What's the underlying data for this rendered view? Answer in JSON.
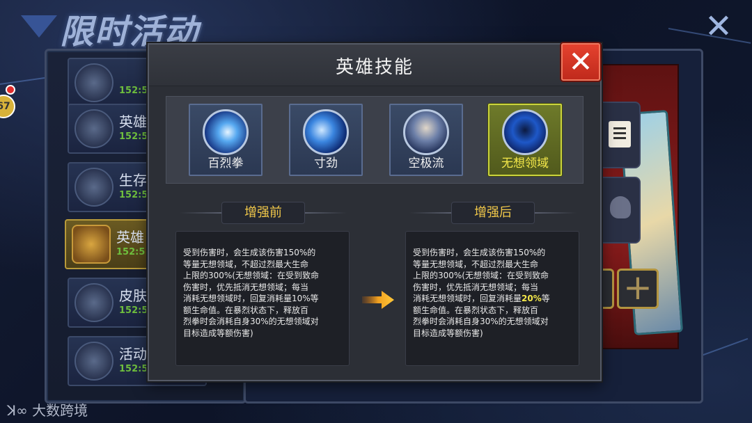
{
  "background": {
    "page_title": "限时活动",
    "list_items": [
      {
        "label": "",
        "time": "152:5"
      },
      {
        "label": "英雄",
        "time": "152:5"
      },
      {
        "label": "生存",
        "time": "152:5"
      },
      {
        "label": "英雄",
        "time": "152:5"
      },
      {
        "label": "皮肤",
        "time": "152:5"
      },
      {
        "label": "活动",
        "time": "152:5"
      }
    ],
    "badge_text": "67"
  },
  "dialog": {
    "title": "英雄技能",
    "skills": [
      {
        "label": "百烈拳",
        "icon": "fist-strike-icon",
        "selected": false
      },
      {
        "label": "寸劲",
        "icon": "energy-burst-icon",
        "selected": false
      },
      {
        "label": "空极流",
        "icon": "fighter-portrait-icon",
        "selected": false
      },
      {
        "label": "无想领域",
        "icon": "aura-silhouette-icon",
        "selected": true
      }
    ],
    "before": {
      "title": "增强前",
      "text_lines": [
        "受到伤害时，会生成该伤害150%的",
        "等量无想领域，不超过烈最大生命",
        "上限的300%(无想领域：在受到致命",
        "伤害时，优先抵消无想领域；每当",
        "消耗无想领域时，回复消耗量10%等",
        "额生命值。在暴烈状态下，释放百",
        "烈拳时会消耗自身30%的无想领域对",
        "目标造成等额伤害)"
      ]
    },
    "after": {
      "title": "增强后",
      "line1": "受到伤害时，会生成该伤害150%的",
      "line2": "等量无想领域，不超过烈最大生命",
      "line3": "上限的300%(无想领域：在受到致命",
      "line4": "伤害时，优先抵消无想领域；每当",
      "line5_pre": "消耗无想领域时，回复消耗量",
      "line5_hl": "20%",
      "line5_post": "等",
      "line6": "额生命值。在暴烈状态下，释放百",
      "line7": "烈拳时会消耗自身30%的无想领域对",
      "line8": "目标造成等额伤害)"
    }
  },
  "watermark": "大数跨境",
  "colors": {
    "accent_gold": "#f2c94a",
    "highlight_yellow": "#f4e84a",
    "close_red": "#d63522",
    "selected_green": "#cbd43c"
  }
}
